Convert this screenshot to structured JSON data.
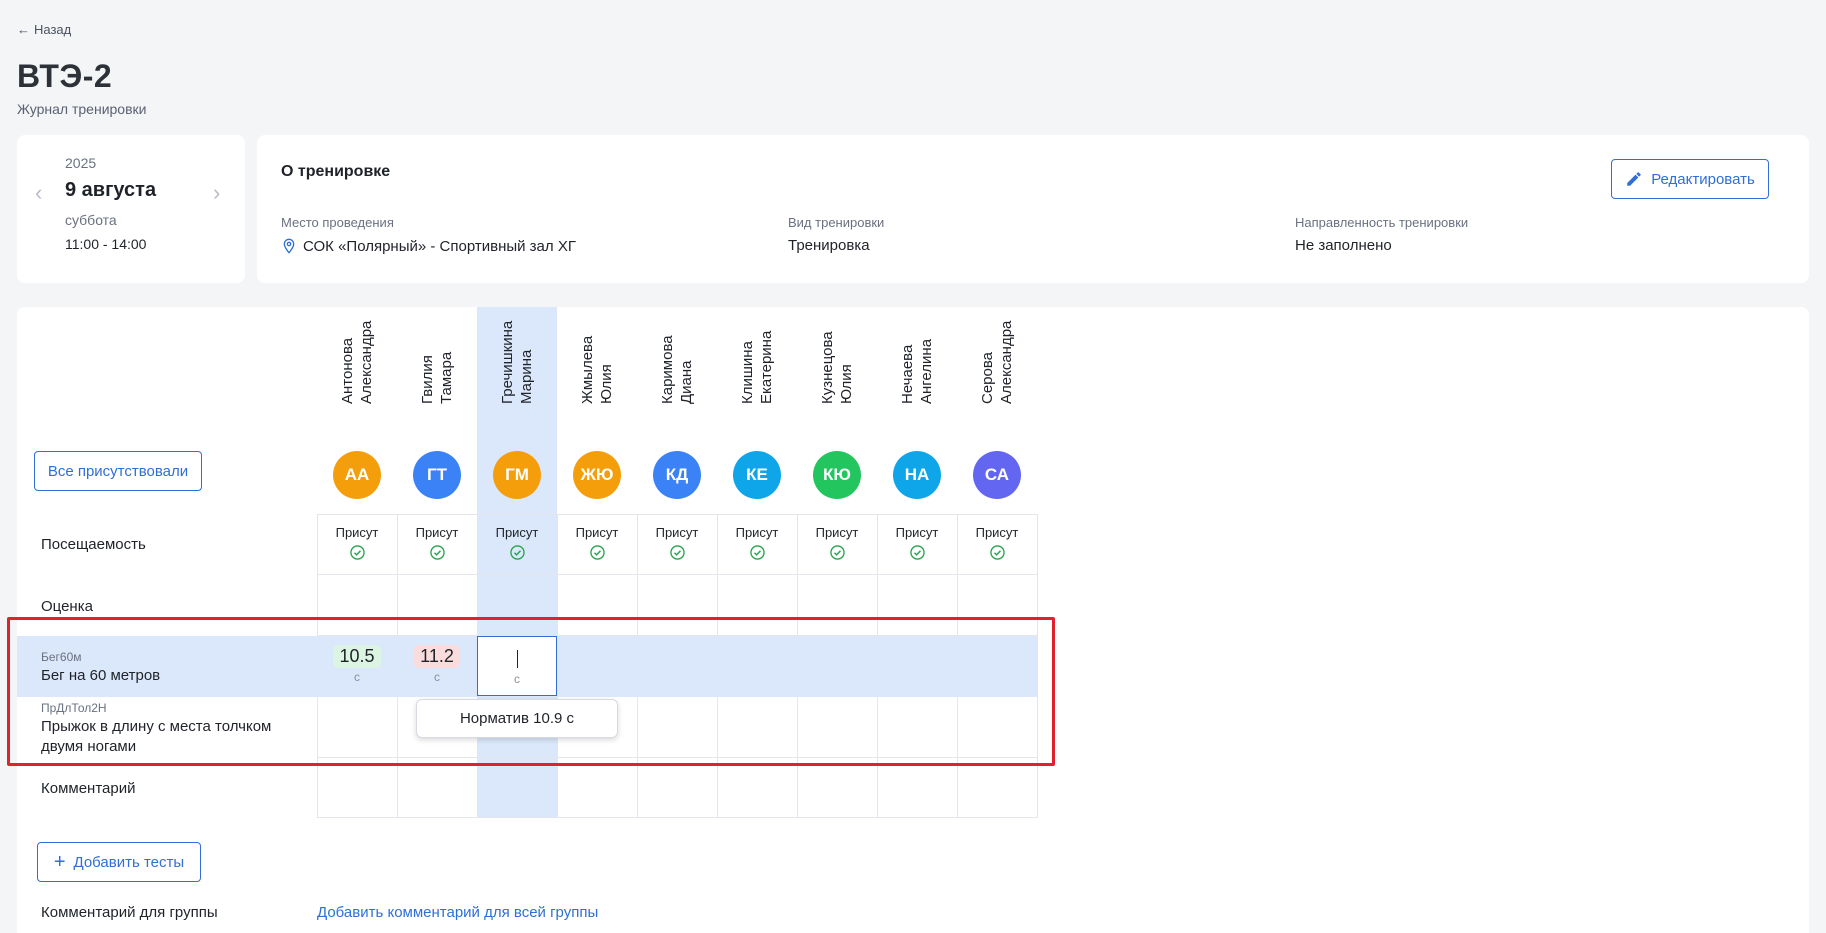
{
  "header": {
    "back_label": "Назад",
    "title": "ВТЭ-2",
    "subtitle": "Журнал тренировки"
  },
  "date_card": {
    "year": "2025",
    "day": "9 августа",
    "weekday": "суббота",
    "time": "11:00 - 14:00"
  },
  "info": {
    "heading": "О тренировке",
    "edit_label": "Редактировать",
    "place_label": "Место проведения",
    "place_value": "СОК «Полярный» - Спортивный зал ХГ",
    "type_label": "Вид тренировки",
    "type_value": "Тренировка",
    "focus_label": "Направленность тренировки",
    "focus_value": "Не заполнено"
  },
  "journal": {
    "all_present_label": "Все присутствовали",
    "athletes": [
      {
        "last": "Антонова",
        "first": "Александра",
        "initials": "АА",
        "color": "#f59e0b"
      },
      {
        "last": "Гвилия",
        "first": "Тамара",
        "initials": "ГТ",
        "color": "#3b82f6"
      },
      {
        "last": "Гречишкина",
        "first": "Марина",
        "initials": "ГМ",
        "color": "#f59e0b"
      },
      {
        "last": "Жмылева",
        "first": "Юлия",
        "initials": "ЖЮ",
        "color": "#f59e0b"
      },
      {
        "last": "Каримова",
        "first": "Диана",
        "initials": "КД",
        "color": "#3b82f6"
      },
      {
        "last": "Клишина",
        "first": "Екатерина",
        "initials": "КЕ",
        "color": "#0ea5e9"
      },
      {
        "last": "Кузнецова",
        "first": "Юлия",
        "initials": "КЮ",
        "color": "#22c55e"
      },
      {
        "last": "Нечаева",
        "first": "Ангелина",
        "initials": "НА",
        "color": "#0ea5e9"
      },
      {
        "last": "Серова",
        "first": "Александра",
        "initials": "СА",
        "color": "#6366f1"
      }
    ],
    "rows": {
      "attendance": "Посещаемость",
      "grade": "Оценка",
      "test1_code": "Бег60м",
      "test1_name": "Бег на 60 метров",
      "test2_code": "ПрДлТол2Н",
      "test2_name_line1": "Прыжок в длину с места толчком",
      "test2_name_line2": "двумя ногами",
      "comment": "Комментарий"
    },
    "attendance_status": "Присут",
    "results": [
      {
        "value": "10.5",
        "unit": "с",
        "status": "good"
      },
      {
        "value": "11.2",
        "unit": "с",
        "status": "bad"
      }
    ],
    "edit_unit": "с",
    "tooltip": "Норматив 10.9 с",
    "add_tests_label": "Добавить тесты",
    "group_comment_label": "Комментарий для группы",
    "group_comment_link": "Добавить комментарий для всей группы"
  },
  "colors": {
    "accent": "#2f6fd6",
    "highlight": "#dbe8fb",
    "present_check": "#22a447",
    "annotation": "#e0232b"
  }
}
